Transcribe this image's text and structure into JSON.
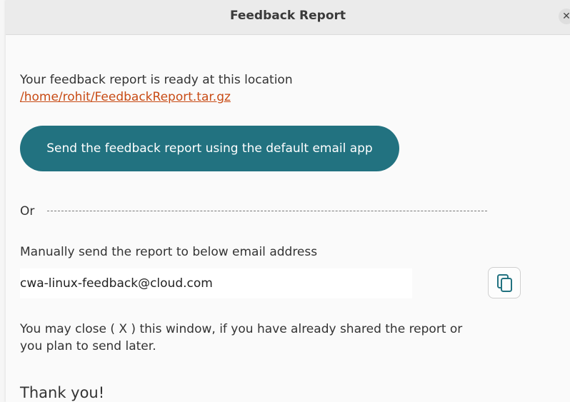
{
  "window": {
    "title": "Feedback Report",
    "close_glyph": "✕"
  },
  "report": {
    "ready_text": "Your feedback report is ready at this location",
    "path_link": "/home/rohit/FeedbackReport.tar.gz"
  },
  "send_button": {
    "label": "Send the feedback report using the default email app"
  },
  "or_label": "Or",
  "manual": {
    "instruction": "Manually send the report to below email address",
    "email": "cwa-linux-feedback@cloud.com",
    "copy_icon": "copy-icon"
  },
  "note": {
    "line1": "You may close ( X ) this window, if you have already shared the report or",
    "line2": "you plan to send later."
  },
  "thanks": "Thank you!",
  "colors": {
    "accent": "#227280",
    "link": "#c84b15"
  }
}
